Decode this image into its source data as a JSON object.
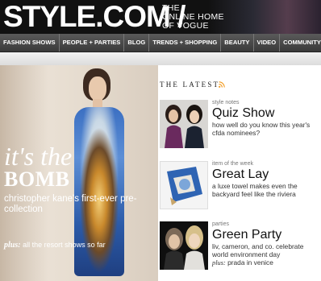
{
  "header": {
    "logo": "STYLE.COM /",
    "tagline_line1": "THE",
    "tagline_line2": "ONLINE HOME",
    "tagline_line3": "OF VOGUE"
  },
  "nav": {
    "items": [
      "FASHION SHOWS",
      "PEOPLE + PARTIES",
      "BLOG",
      "TRENDS + SHOPPING",
      "BEAUTY",
      "VIDEO",
      "COMMUNITY"
    ]
  },
  "hero": {
    "title_line1": "it's the",
    "title_line2": "BOMB",
    "subtitle": "christopher kane's first-ever pre-collection",
    "plus_label": "plus:",
    "plus_text": "all the resort shows so far"
  },
  "latest": {
    "heading": "THE LATEST",
    "rss_icon": "rss-icon",
    "items": [
      {
        "category": "style notes",
        "title": "Quiz Show",
        "description": "how well do you know this year's cfda nominees?"
      },
      {
        "category": "item of the week",
        "title": "Great Lay",
        "description": "a luxe towel makes even the backyard feel like the riviera"
      },
      {
        "category": "parties",
        "title": "Green Party",
        "description": "liv, cameron, and co. celebrate world environment day",
        "plus_label": "plus:",
        "plus_text": "prada in venice"
      }
    ]
  },
  "colors": {
    "header_bg": "#111111",
    "nav_bg": "#4a4a4a",
    "rss_orange": "#f39a1e"
  }
}
